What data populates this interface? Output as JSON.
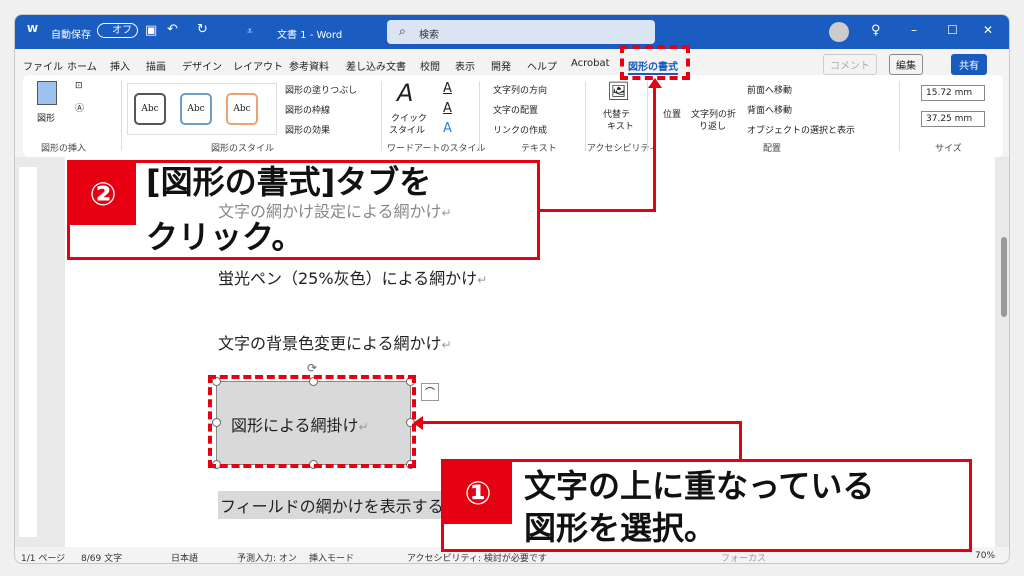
{
  "titlebar": {
    "autosave_label": "自動保存",
    "autosave_state": "オフ",
    "doc_title": "文書 1 - Word",
    "search_placeholder": "検索"
  },
  "tabs": [
    "ファイル",
    "ホーム",
    "挿入",
    "描画",
    "デザイン",
    "レイアウト",
    "参考資料",
    "差し込み文書",
    "校閲",
    "表示",
    "開発",
    "ヘルプ",
    "Acrobat",
    "図形の書式"
  ],
  "right_buttons": {
    "comment": "コメント",
    "edit": "編集",
    "share": "共有"
  },
  "ribbon": {
    "insert_shapes": {
      "shapes": "図形",
      "group": "図形の挿入"
    },
    "shape_styles": {
      "sample": "Abc",
      "fill": "図形の塗りつぶし",
      "outline": "図形の枠線",
      "effects": "図形の効果",
      "group": "図形のスタイル"
    },
    "wordart": {
      "quick": "クイック",
      "style": "スタイル",
      "group": "ワードアートのスタイル"
    },
    "text": {
      "direction": "文字列の方向",
      "align": "文字の配置",
      "link": "リンクの作成",
      "group": "テキスト"
    },
    "accessibility": {
      "alt1": "代替テ",
      "alt2": "キスト",
      "group": "アクセシビリティ"
    },
    "arrange": {
      "position": "位置",
      "wrap1": "文字列の折",
      "wrap2": "り返し",
      "forward": "前面へ移動",
      "backward": "背面へ移動",
      "selection": "オブジェクトの選択と表示",
      "group": "配置"
    },
    "size": {
      "height": "15.72 mm",
      "width": "37.25 mm",
      "group": "サイズ"
    }
  },
  "document": {
    "lines": [
      "文字の網かけ設定による網かけ",
      "蛍光ペン（25%灰色）による網かけ",
      "文字の背景色変更による網かけ",
      "図形による網掛け",
      "フィールドの網かけを表示する場合"
    ],
    "return_mark": "↵"
  },
  "status": {
    "page": "1/1 ページ",
    "words": "8/69 文字",
    "lang": "日本語",
    "predict": "予測入力: オン",
    "insert": "挿入モード",
    "access": "アクセシビリティ: 検討が必要です",
    "focus": "フォーカス",
    "zoom": "70%"
  },
  "callouts": [
    {
      "number": "①",
      "line1": "文字の上に重なっている",
      "line2": "図形を選択。"
    },
    {
      "number": "②",
      "line1": "[図形の書式]タブを",
      "line2": "クリック。"
    }
  ],
  "colors": {
    "title_bar": "#1a5cc0",
    "accent_red": "#e60012",
    "active_tab": "#185abd"
  }
}
